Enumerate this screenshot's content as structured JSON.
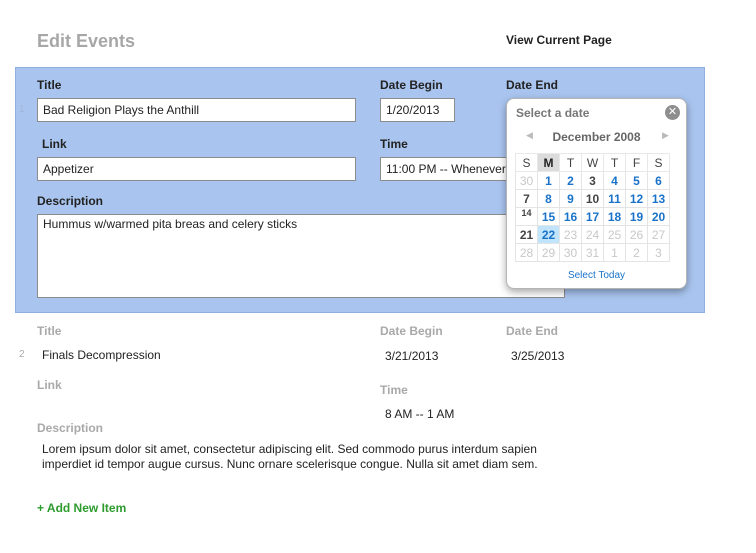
{
  "page": {
    "title": "Edit Events",
    "view_link": "View Current Page"
  },
  "editing_item": {
    "row_number": "1",
    "title_label": "Title",
    "title_value": "Bad Religion Plays the Anthill",
    "link_label": "Link",
    "link_value": "Appetizer",
    "date_begin_label": "Date Begin",
    "date_begin_value": "1/20/2013",
    "date_end_label": "Date End",
    "time_label": "Time",
    "time_value": "11:00 PM -- Whenever",
    "description_label": "Description",
    "description_value": "Hummus w/warmed pita breas and celery sticks"
  },
  "date_picker": {
    "header": "Select a date",
    "month": "December 2008",
    "weekdays": [
      "S",
      "M",
      "T",
      "W",
      "T",
      "F",
      "S"
    ],
    "weeks": [
      [
        "30",
        "1",
        "2",
        "3",
        "4",
        "5",
        "6"
      ],
      [
        "7",
        "8",
        "9",
        "10",
        "11",
        "12",
        "13"
      ],
      [
        "14",
        "15",
        "16",
        "17",
        "18",
        "19",
        "20"
      ],
      [
        "21",
        "22",
        "23",
        "24",
        "25",
        "26",
        "27"
      ],
      [
        "28",
        "29",
        "30",
        "31",
        "1",
        "2",
        "3"
      ]
    ],
    "selected_day": "22",
    "select_today": "Select Today"
  },
  "second_item": {
    "row_number": "2",
    "title_label": "Title",
    "title_value": "Finals Decompression",
    "date_begin_label": "Date Begin",
    "date_begin_value": "3/21/2013",
    "date_end_label": "Date End",
    "date_end_value": "3/25/2013",
    "link_label": "Link",
    "time_label": "Time",
    "time_value": "8 AM -- 1 AM",
    "description_label": "Description",
    "description_value": "Lorem ipsum dolor sit amet, consectetur adipiscing elit. Sed commodo purus interdum sapien imperdiet id tempor augue cursus. Nunc ornare scelerisque congue. Nulla sit amet diam sem."
  },
  "add_item": "+ Add New Item"
}
